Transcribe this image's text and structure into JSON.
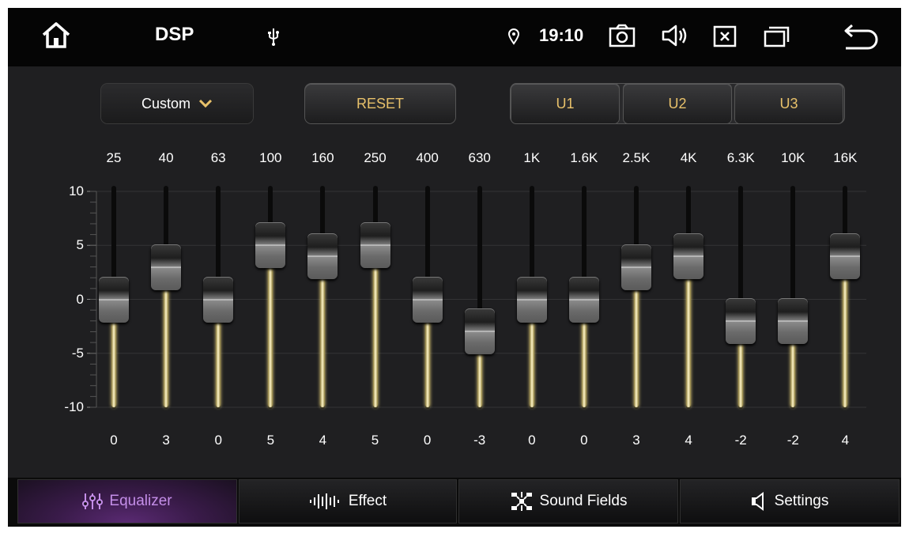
{
  "status": {
    "title": "DSP",
    "time": "19:10",
    "icons": [
      "home-icon",
      "usb-icon",
      "location-icon",
      "camera-icon",
      "volume-icon",
      "close-box-icon",
      "recent-apps-icon",
      "back-icon"
    ]
  },
  "controls": {
    "preset_label": "Custom",
    "reset_label": "RESET",
    "user_presets": [
      "U1",
      "U2",
      "U3"
    ]
  },
  "equalizer": {
    "y_axis": {
      "ticks": [
        "10",
        "5",
        "0",
        "-5",
        "-10"
      ],
      "range": [
        -10,
        10
      ]
    },
    "bands": [
      {
        "freq": "25",
        "gain": "0"
      },
      {
        "freq": "40",
        "gain": "3"
      },
      {
        "freq": "63",
        "gain": "0"
      },
      {
        "freq": "100",
        "gain": "5"
      },
      {
        "freq": "160",
        "gain": "4"
      },
      {
        "freq": "250",
        "gain": "5"
      },
      {
        "freq": "400",
        "gain": "0"
      },
      {
        "freq": "630",
        "gain": "-3"
      },
      {
        "freq": "1K",
        "gain": "0"
      },
      {
        "freq": "1.6K",
        "gain": "0"
      },
      {
        "freq": "2.5K",
        "gain": "3"
      },
      {
        "freq": "4K",
        "gain": "4"
      },
      {
        "freq": "6.3K",
        "gain": "-2"
      },
      {
        "freq": "10K",
        "gain": "-2"
      },
      {
        "freq": "16K",
        "gain": "4"
      }
    ]
  },
  "tabs": [
    {
      "label": "Equalizer",
      "icon": "equalizer-icon",
      "active": true
    },
    {
      "label": "Effect",
      "icon": "effect-icon",
      "active": false
    },
    {
      "label": "Sound Fields",
      "icon": "sound-fields-icon",
      "active": false
    },
    {
      "label": "Settings",
      "icon": "speaker-icon",
      "active": false
    }
  ],
  "colors": {
    "accent": "#e8c16a",
    "active_tab": "#c48ee8",
    "background": "#1f1f21"
  }
}
